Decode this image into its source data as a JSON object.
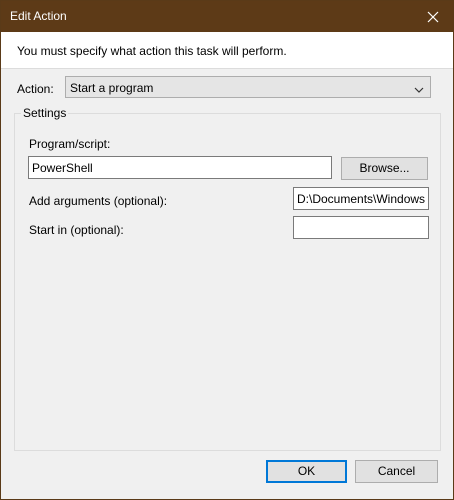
{
  "window": {
    "title": "Edit Action",
    "close_icon": "close-icon"
  },
  "instruction": "You must specify what action this task will perform.",
  "action": {
    "label": "Action:",
    "selected": "Start a program"
  },
  "settings": {
    "legend": "Settings",
    "program_label": "Program/script:",
    "program_value": "PowerShell",
    "browse_label": "Browse...",
    "arguments_label": "Add arguments (optional):",
    "arguments_value": "D:\\Documents\\Windows",
    "startin_label": "Start in (optional):",
    "startin_value": ""
  },
  "buttons": {
    "ok": "OK",
    "cancel": "Cancel"
  },
  "colors": {
    "titlebar": "#5d3a17",
    "accent": "#0078d7"
  }
}
